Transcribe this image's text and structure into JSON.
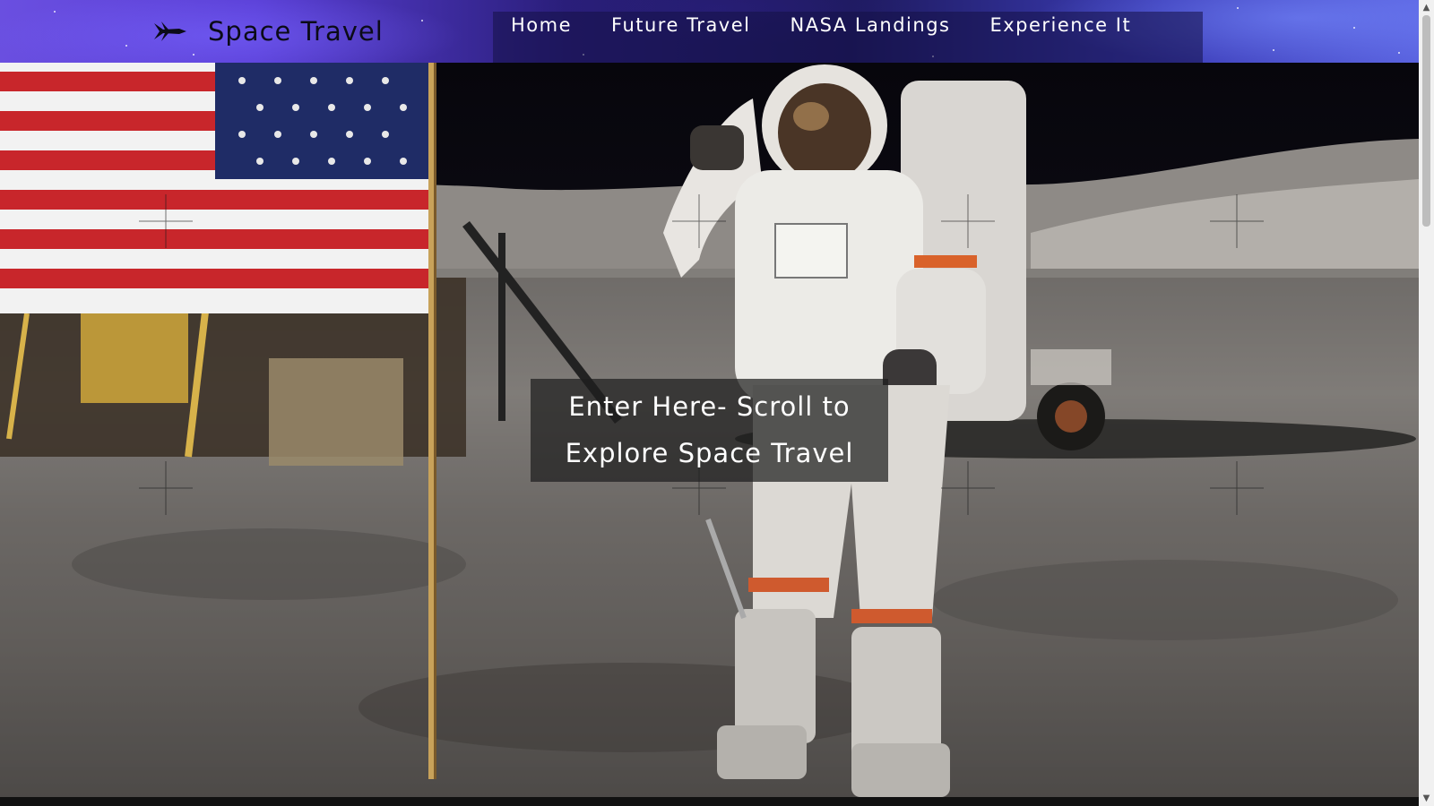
{
  "header": {
    "logo_icon": "spaceship-icon",
    "site_title": "Space Travel",
    "nav": [
      {
        "label": "Home"
      },
      {
        "label": "Future Travel"
      },
      {
        "label": "NASA Landings"
      },
      {
        "label": "Experience It"
      }
    ]
  },
  "hero": {
    "background": "astronaut-on-moon-photo",
    "caption_line1": "Enter Here- Scroll to",
    "caption_line2": "Explore Space Travel"
  },
  "colors": {
    "header_purple": "#5a3fd6",
    "nav_overlay": "#14104a",
    "caption_bg": "#1e1e1e",
    "text_white": "#ffffff"
  }
}
